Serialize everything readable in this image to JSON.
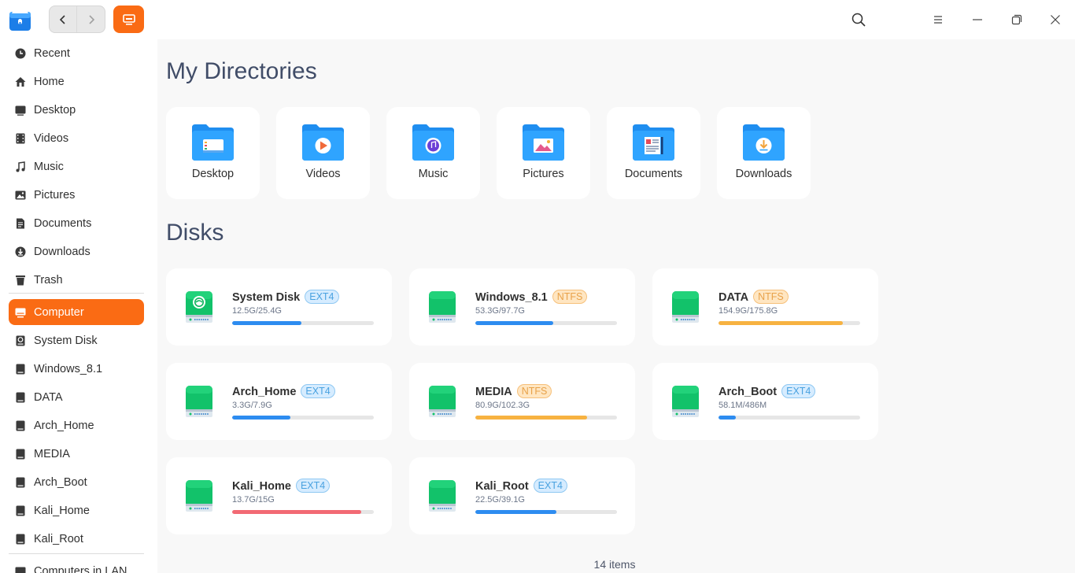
{
  "titlebar": {
    "icons": [
      "file-manager-logo-icon",
      "back-arrow-icon",
      "forward-arrow-icon",
      "computer-view-icon",
      "search-icon",
      "menu-icon",
      "minimize-icon",
      "maximize-icon",
      "close-icon"
    ]
  },
  "sidebar": {
    "items": [
      {
        "label": "Recent",
        "icon": "clock-icon"
      },
      {
        "label": "Home",
        "icon": "home-icon"
      },
      {
        "label": "Desktop",
        "icon": "desktop-icon"
      },
      {
        "label": "Videos",
        "icon": "film-icon"
      },
      {
        "label": "Music",
        "icon": "music-note-icon"
      },
      {
        "label": "Pictures",
        "icon": "picture-icon"
      },
      {
        "label": "Documents",
        "icon": "document-icon"
      },
      {
        "label": "Downloads",
        "icon": "download-icon"
      },
      {
        "label": "Trash",
        "icon": "trash-icon"
      }
    ],
    "devices": [
      {
        "label": "Computer",
        "icon": "computer-icon",
        "active": true
      },
      {
        "label": "System Disk",
        "icon": "system-disk-icon"
      },
      {
        "label": "Windows_8.1",
        "icon": "disk-icon"
      },
      {
        "label": "DATA",
        "icon": "disk-icon"
      },
      {
        "label": "Arch_Home",
        "icon": "disk-icon"
      },
      {
        "label": "MEDIA",
        "icon": "disk-icon"
      },
      {
        "label": "Arch_Boot",
        "icon": "disk-icon"
      },
      {
        "label": "Kali_Home",
        "icon": "disk-icon"
      },
      {
        "label": "Kali_Root",
        "icon": "disk-icon"
      }
    ],
    "network": {
      "label": "Computers in LAN",
      "icon": "network-icon"
    }
  },
  "main": {
    "directories_title": "My Directories",
    "directories": [
      {
        "label": "Desktop",
        "icon": "desktop-folder-icon"
      },
      {
        "label": "Videos",
        "icon": "videos-folder-icon"
      },
      {
        "label": "Music",
        "icon": "music-folder-icon"
      },
      {
        "label": "Pictures",
        "icon": "pictures-folder-icon"
      },
      {
        "label": "Documents",
        "icon": "documents-folder-icon"
      },
      {
        "label": "Downloads",
        "icon": "downloads-folder-icon"
      }
    ],
    "disks_title": "Disks",
    "disks": [
      {
        "name": "System Disk",
        "fs": "EXT4",
        "size": "12.5G/25.4G",
        "usage": 0.49,
        "color": "#2d8cf0",
        "system": true
      },
      {
        "name": "Windows_8.1",
        "fs": "NTFS",
        "size": "53.3G/97.7G",
        "usage": 0.55,
        "color": "#2d8cf0"
      },
      {
        "name": "DATA",
        "fs": "NTFS",
        "size": "154.9G/175.8G",
        "usage": 0.88,
        "color": "#f7b241"
      },
      {
        "name": "Arch_Home",
        "fs": "EXT4",
        "size": "3.3G/7.9G",
        "usage": 0.41,
        "color": "#2d8cf0"
      },
      {
        "name": "MEDIA",
        "fs": "NTFS",
        "size": "80.9G/102.3G",
        "usage": 0.79,
        "color": "#f7b241"
      },
      {
        "name": "Arch_Boot",
        "fs": "EXT4",
        "size": "58.1M/486M",
        "usage": 0.12,
        "color": "#2d8cf0"
      },
      {
        "name": "Kali_Home",
        "fs": "EXT4",
        "size": "13.7G/15G",
        "usage": 0.91,
        "color": "#f26a74"
      },
      {
        "name": "Kali_Root",
        "fs": "EXT4",
        "size": "22.5G/39.1G",
        "usage": 0.57,
        "color": "#2d8cf0"
      }
    ],
    "status": "14 items"
  }
}
